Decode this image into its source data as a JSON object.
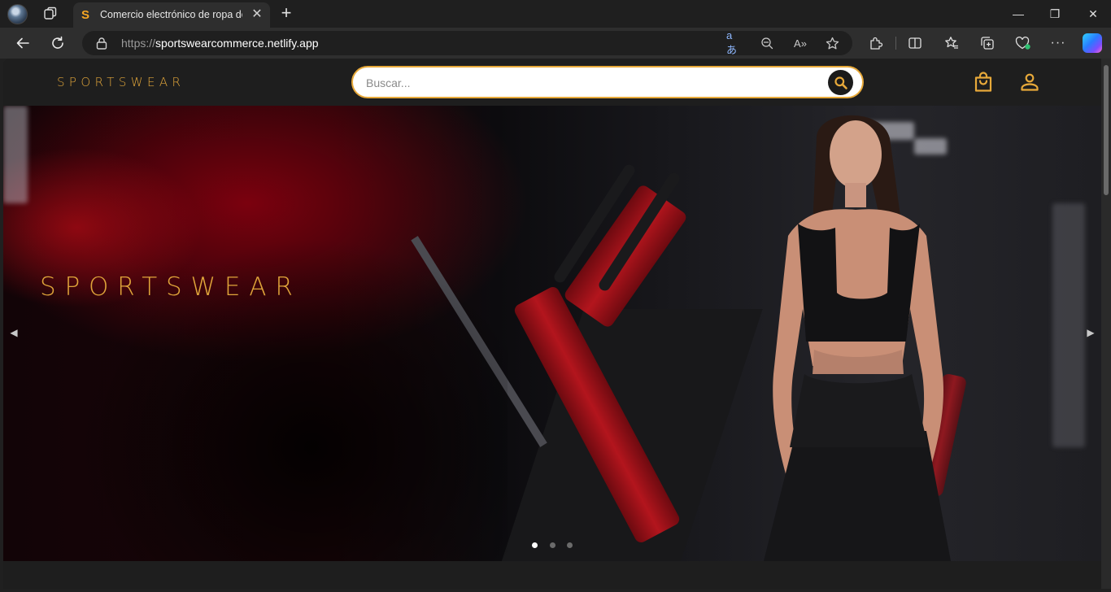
{
  "browser": {
    "tab": {
      "favicon": "S",
      "title": "Comercio electrónico de ropa deportiva",
      "close": "✕"
    },
    "new_tab": "+",
    "window_controls": {
      "minimize": "—",
      "restore": "❐",
      "close": "✕"
    },
    "address": {
      "protocol": "https://",
      "host": "sportswearcommerce.netlify.app"
    },
    "icons": [
      "profile-avatar",
      "workspaces-icon",
      "back-icon",
      "refresh-icon",
      "lock-icon",
      "translate-icon",
      "zoom-out-icon",
      "read-aloud-icon",
      "favorite-star-icon",
      "extensions-icon",
      "split-screen-icon",
      "favorites-icon",
      "collections-icon",
      "browser-essentials-icon",
      "more-icon",
      "copilot-icon"
    ],
    "address_icon_text": {
      "translate": "aあ",
      "read_aloud": "A»"
    },
    "more_label": "···"
  },
  "site": {
    "logo": "SPORTSWEAR",
    "search": {
      "placeholder": "Buscar..."
    },
    "accent_color": "#e0a53a",
    "header_icons": [
      "search-icon",
      "shopping-bag-icon",
      "user-icon"
    ],
    "hero": {
      "title": "SPORTSWEAR",
      "arrow_prev": "◀",
      "arrow_next": "▶",
      "slides_count": 3,
      "active_slide": 1
    }
  }
}
